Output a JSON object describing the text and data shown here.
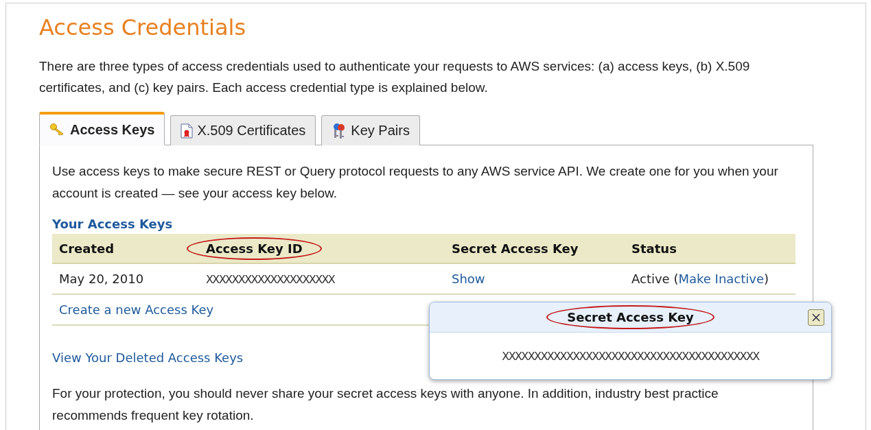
{
  "title": "Access Credentials",
  "intro": "There are three types of access credentials used to authenticate your requests to AWS services: (a) access keys, (b) X.509 certificates, and (c) key pairs. Each access credential type is explained below.",
  "tabs": [
    {
      "label": "Access Keys",
      "selected": true
    },
    {
      "label": "X.509 Certificates",
      "selected": false
    },
    {
      "label": "Key Pairs",
      "selected": false
    }
  ],
  "panel": {
    "description": "Use access keys to make secure REST or Query protocol requests to any AWS service API. We create one for you when your account is created — see your access key below.",
    "section_title": "Your Access Keys",
    "table": {
      "columns": [
        {
          "label": "Created",
          "circled": false
        },
        {
          "label": "Access Key ID",
          "circled": true
        },
        {
          "label": "Secret Access Key",
          "circled": false
        },
        {
          "label": "Status",
          "circled": false
        }
      ],
      "rows": [
        {
          "created": "May 20, 2010",
          "access_key_id": "XXXXXXXXXXXXXXXXXXXX",
          "secret": "Show",
          "status": {
            "before": "Active (",
            "link": "Make Inactive",
            "after": ")"
          }
        }
      ]
    },
    "create_link": "Create a new Access Key",
    "deleted_link": "View Your Deleted Access Keys",
    "note": "For your protection, you should never share your secret access keys with anyone. In addition, industry best practice recommends frequent key rotation."
  },
  "popup": {
    "title": "Secret Access Key",
    "circled": true,
    "value": "XXXXXXXXXXXXXXXXXXXXXXXXXXXXXXXXXXXXXXXX"
  }
}
